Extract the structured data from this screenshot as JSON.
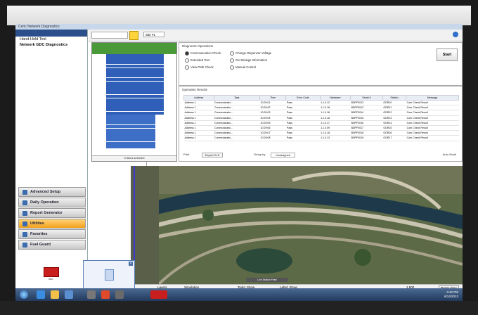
{
  "window": {
    "title": "Ceric Network Diagnostics"
  },
  "sidebar": {
    "items": [
      "Hand-Held Test",
      "Network GDC Diagnostics"
    ],
    "nav": [
      "Advanced Setup",
      "Daily Operation",
      "Report Generator",
      "Utilities",
      "Favorites",
      "Fuel Guard"
    ],
    "active": "Utilities",
    "tool_label": "Info"
  },
  "toolbar": {
    "select_value": "Site #1"
  },
  "tree": {
    "footer": "0 items selected"
  },
  "diagnostic": {
    "heading": "Diagnostic Operations",
    "options": [
      "Communication Check",
      "Extended Test",
      "View Path Check",
      "Change Dispenser Voltage",
      "Get Dialogs Information",
      "Manual Control"
    ],
    "selected": "Communication Check",
    "start_label": "Start"
  },
  "results": {
    "heading": "Operation Results",
    "columns": [
      "Address",
      "Task",
      "Time",
      "Error Code",
      "Hardware",
      "Serial #",
      "Station",
      "Message"
    ],
    "rows": [
      [
        "Address 1",
        "Communicatio...",
        "10:29:01",
        "Pass",
        "1.1.0.12",
        "BDPF0012",
        "GDR10",
        "Com Check Result"
      ],
      [
        "Address 1",
        "Communicatio...",
        "10:29:02",
        "Pass",
        "1.1.0.18",
        "BDPF0013",
        "GDR11",
        "Com Check Result"
      ],
      [
        "Address 1",
        "Communicatio...",
        "10:29:03",
        "Pass",
        "1.1.0.18",
        "BDPF0014",
        "GDR12",
        "Com Check Result"
      ],
      [
        "Address 1",
        "Communicatio...",
        "10:29:04",
        "Pass",
        "1.1.0.18",
        "BDPF0015",
        "GDR13",
        "Com Check Result"
      ],
      [
        "Address 1",
        "Communicatio...",
        "10:29:05",
        "Pass",
        "1.1.0.17",
        "BDPF0016",
        "GDR14",
        "Com Check Result"
      ],
      [
        "Address 1",
        "Communicatio...",
        "10:29:06",
        "Pass",
        "1.1.0.09",
        "BDPF0017",
        "GDR15",
        "Com Check Result"
      ],
      [
        "Address 1",
        "Communicatio...",
        "10:29:07",
        "Pass",
        "1.1.0.18",
        "BDPF0018",
        "GDR16",
        "Com Check Result"
      ],
      [
        "Address 1",
        "Communicatio...",
        "10:29:08",
        "Pass",
        "1.1.0.13",
        "BDPF0019",
        "GDR17",
        "Com Check Result"
      ]
    ],
    "footer": {
      "print": "Print",
      "export": "Export XLS",
      "group_by": "Group by",
      "group_value": "Unassigned",
      "auto_scroll": "Auto Scroll"
    }
  },
  "map": {
    "tools": [
      "Layers",
      "Simulation",
      "Tools: Show",
      "Label: Show"
    ],
    "zoom": "1,500",
    "status": "Live Station Feed",
    "recenter": "Reset View"
  },
  "taskbar": {
    "time": "3:42 PM",
    "date": "6/14/2013"
  },
  "colors": {
    "tree_header": "#4a9a3a",
    "selection": "#2f5fb8",
    "active_nav": "#f3a21a",
    "taskbar": "#22395c"
  }
}
